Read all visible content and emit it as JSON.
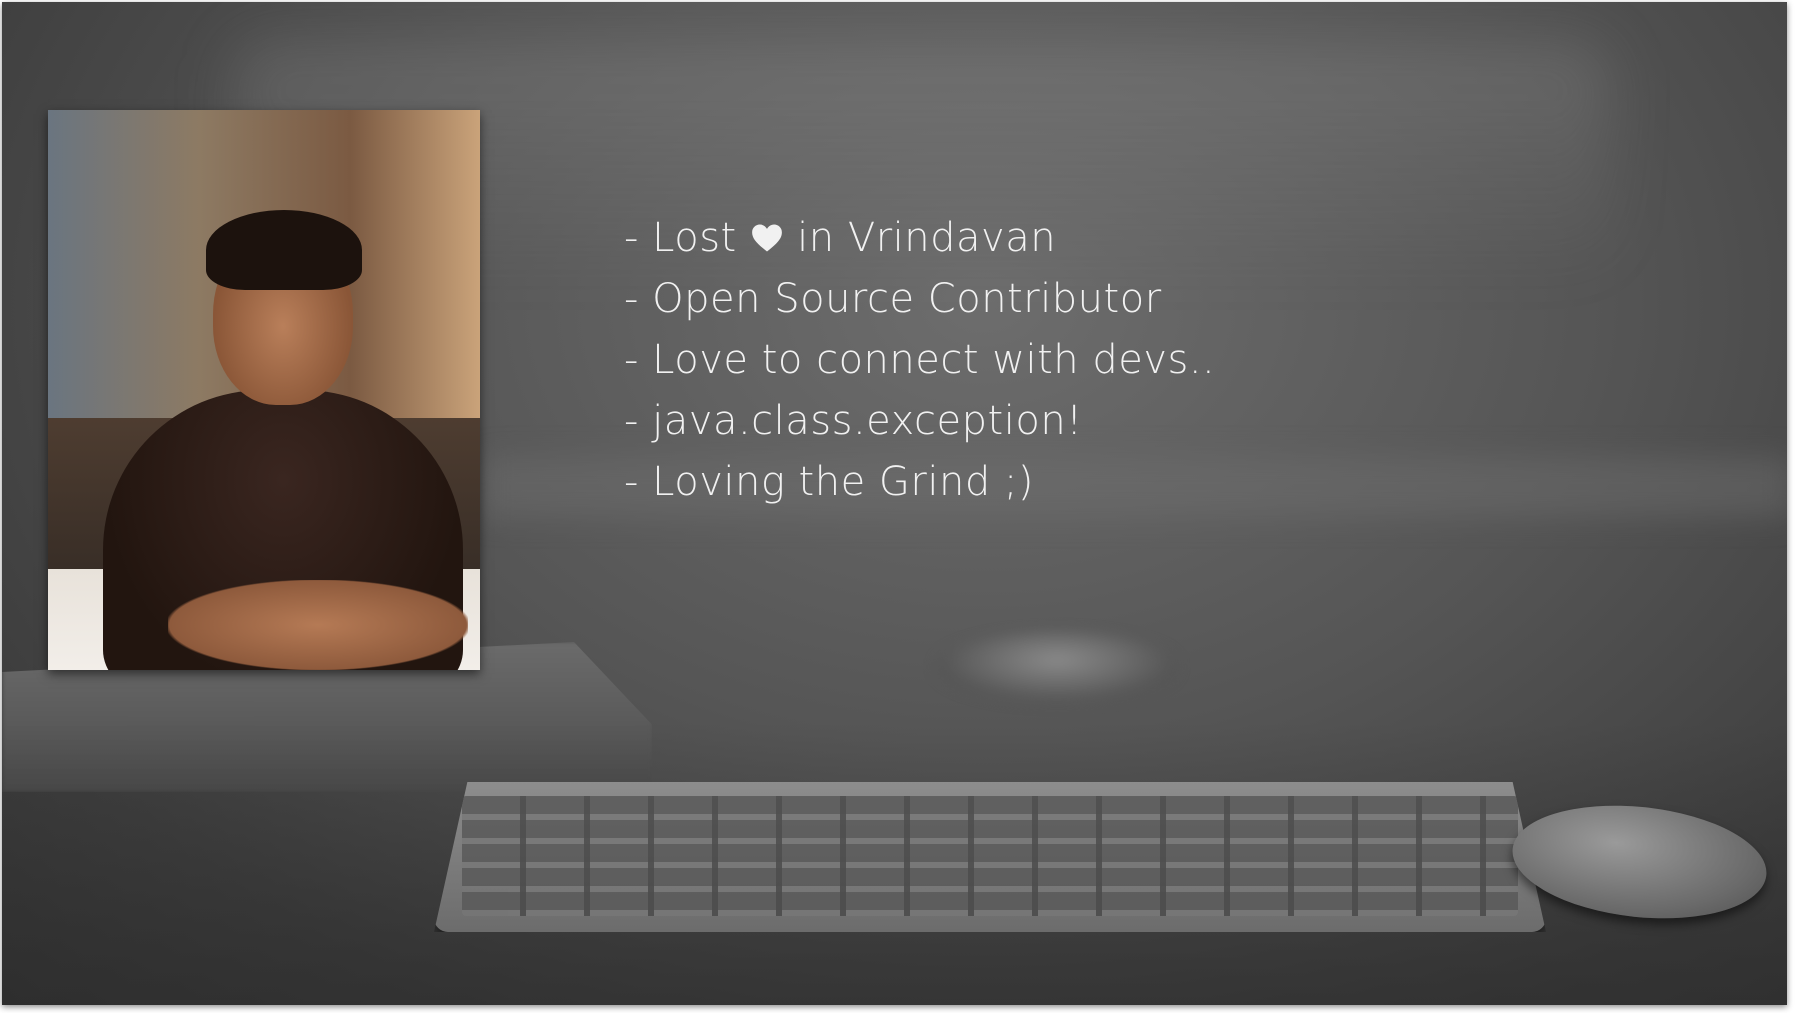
{
  "slide": {
    "bio_items": [
      {
        "prefix": "- Lost ",
        "icon": "heart-icon",
        "suffix": " in Vrindavan"
      },
      {
        "text": "- Open Source Contributor"
      },
      {
        "text": "- Love to connect with devs.."
      },
      {
        "text": "- java.class.exception!"
      },
      {
        "text": "- Loving the Grind ;)"
      }
    ],
    "colors": {
      "text": "#f1f1f1",
      "background": "#555555"
    }
  }
}
